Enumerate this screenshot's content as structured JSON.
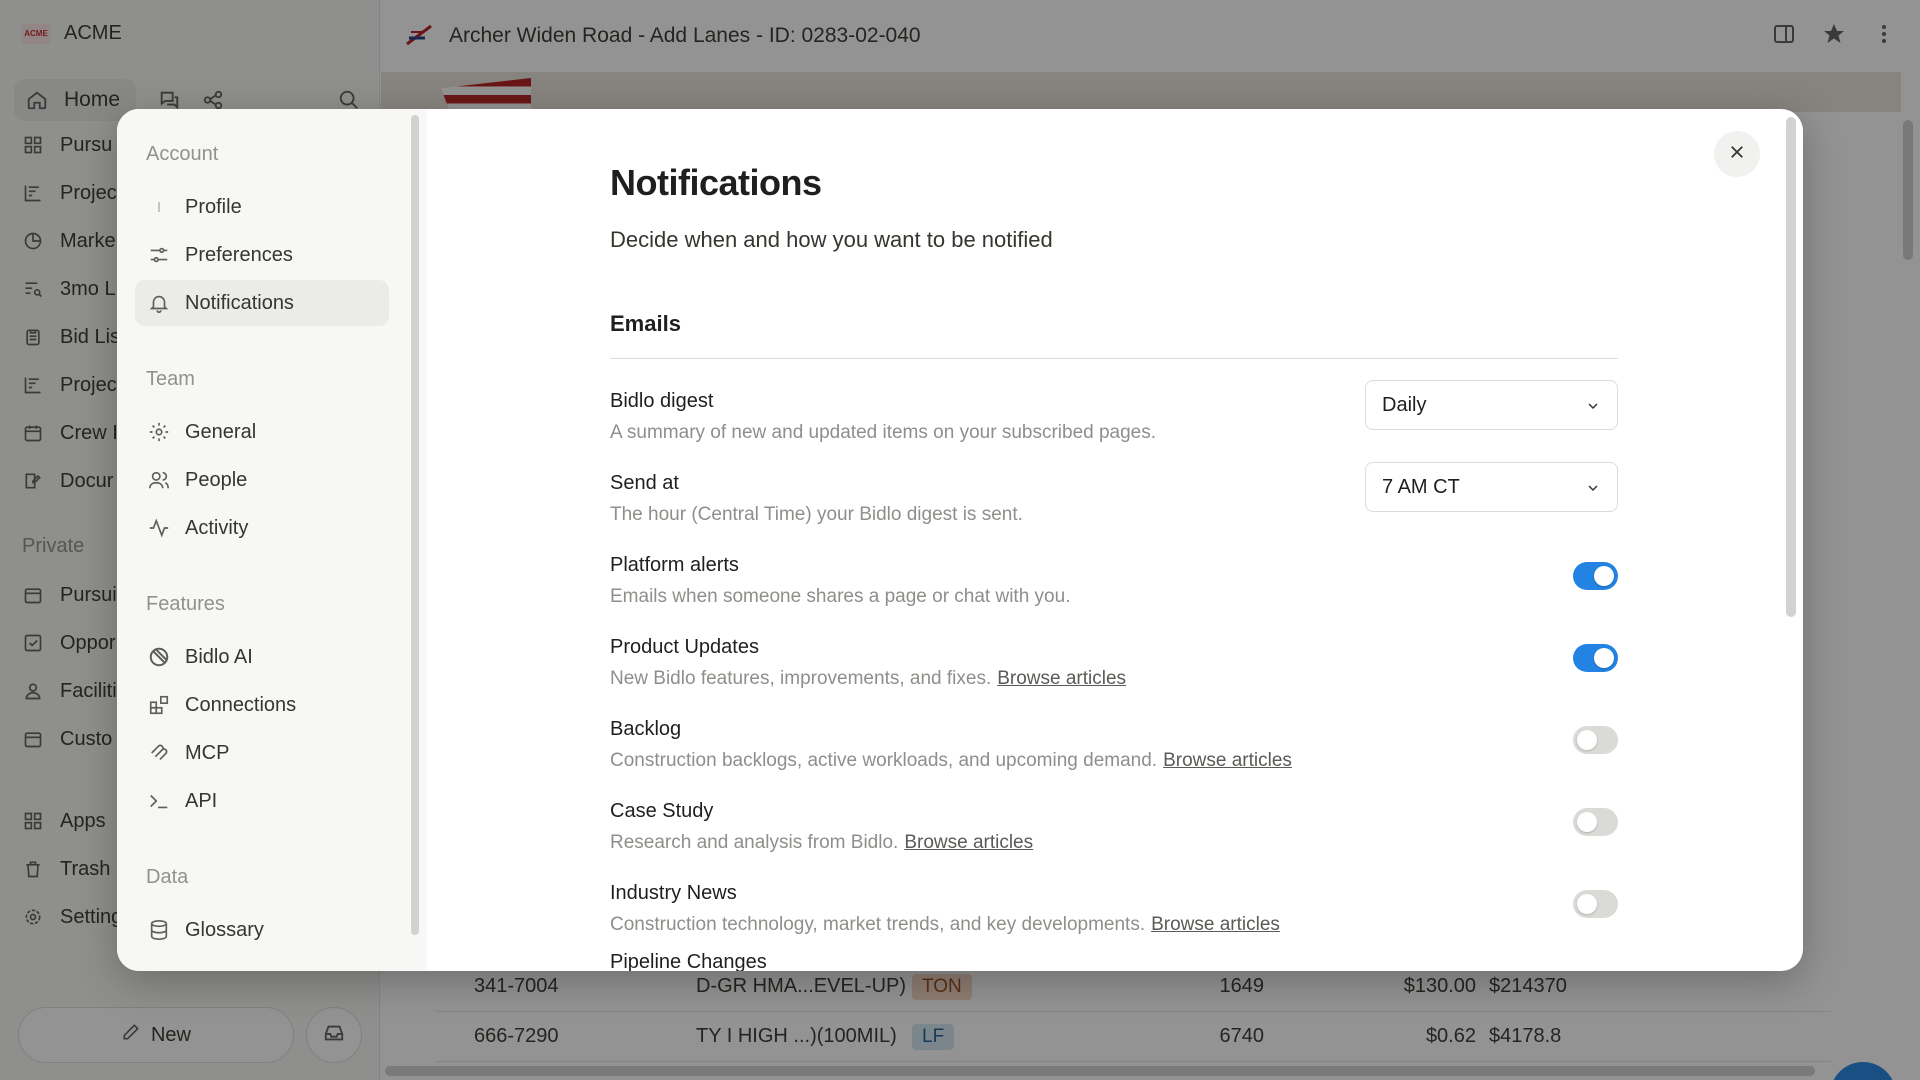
{
  "workspace": {
    "name": "ACME",
    "logo_text": "ACME"
  },
  "sidebar": {
    "home_label": "Home",
    "items": [
      {
        "label": "Pursu",
        "icon": "grid-icon"
      },
      {
        "label": "Projec",
        "icon": "chart-icon"
      },
      {
        "label": "Marke",
        "icon": "pie-icon"
      },
      {
        "label": "3mo L",
        "icon": "list-search-icon"
      },
      {
        "label": "Bid Lis",
        "icon": "clipboard-icon"
      },
      {
        "label": "Projec",
        "icon": "chart-icon"
      },
      {
        "label": "Crew I",
        "icon": "calendar-icon"
      },
      {
        "label": "Docur",
        "icon": "edit-doc-icon"
      }
    ],
    "private_label": "Private",
    "private_items": [
      {
        "label": "Pursui",
        "icon": "calendar-icon"
      },
      {
        "label": "Oppor",
        "icon": "checkbox-icon"
      },
      {
        "label": "Faciliti",
        "icon": "person-icon"
      },
      {
        "label": "Custo",
        "icon": "calendar-icon"
      }
    ],
    "bottom_items": [
      {
        "label": "Apps",
        "icon": "apps-icon"
      },
      {
        "label": "Trash",
        "icon": "trash-icon"
      },
      {
        "label": "Setting",
        "icon": "gear-icon"
      }
    ],
    "new_label": "New"
  },
  "topbar": {
    "title": "Archer Widen Road - Add Lanes - ID: 0283-02-040"
  },
  "table": {
    "rows": [
      {
        "code": "341-7004",
        "item": "D-GR HMA...EVEL-UP)",
        "unit": "TON",
        "unit_color": "#f6d8c4",
        "qty": "1649",
        "price": "$130.00",
        "total": "$214370"
      },
      {
        "code": "666-7290",
        "item": "TY I HIGH ...)(100MIL)",
        "unit": "LF",
        "unit_color": "#d3e5f3",
        "qty": "6740",
        "price": "$0.62",
        "total": "$4178.8"
      }
    ]
  },
  "settings_nav": {
    "sections": [
      {
        "title": "Account",
        "items": [
          {
            "label": "Profile",
            "icon": "profile-icon"
          },
          {
            "label": "Preferences",
            "icon": "sliders-icon"
          },
          {
            "label": "Notifications",
            "icon": "bell-icon",
            "active": true
          }
        ]
      },
      {
        "title": "Team",
        "items": [
          {
            "label": "General",
            "icon": "gear-icon"
          },
          {
            "label": "People",
            "icon": "people-icon"
          },
          {
            "label": "Activity",
            "icon": "activity-icon"
          }
        ]
      },
      {
        "title": "Features",
        "items": [
          {
            "label": "Bidlo AI",
            "icon": "ai-icon"
          },
          {
            "label": "Connections",
            "icon": "connections-icon"
          },
          {
            "label": "MCP",
            "icon": "mcp-icon"
          },
          {
            "label": "API",
            "icon": "terminal-icon"
          }
        ]
      },
      {
        "title": "Data",
        "items": [
          {
            "label": "Glossary",
            "icon": "database-icon"
          }
        ]
      }
    ]
  },
  "notifications": {
    "title": "Notifications",
    "subtitle": "Decide when and how you want to be notified",
    "section_title": "Emails",
    "settings": [
      {
        "label": "Bidlo digest",
        "desc": "A summary of new and updated items on your subscribed pages.",
        "control": "select",
        "value": "Daily"
      },
      {
        "label": "Send at",
        "desc": "The hour (Central Time) your Bidlo digest is sent.",
        "control": "select",
        "value": "7 AM CT"
      },
      {
        "label": "Platform alerts",
        "desc": "Emails when someone shares a page or chat with you.",
        "control": "toggle",
        "on": true
      },
      {
        "label": "Product Updates",
        "desc": "New Bidlo features, improvements, and fixes.",
        "link": "Browse articles",
        "control": "toggle",
        "on": true
      },
      {
        "label": "Backlog",
        "desc": "Construction backlogs, active workloads, and upcoming demand.",
        "link": "Browse articles",
        "control": "toggle",
        "on": false
      },
      {
        "label": "Case Study",
        "desc": "Research and analysis from Bidlo.",
        "link": "Browse articles",
        "control": "toggle",
        "on": false
      },
      {
        "label": "Industry News",
        "desc": "Construction technology, market trends, and key developments.",
        "link": "Browse articles",
        "control": "toggle",
        "on": false
      }
    ],
    "cut_label": "Pipeline Changes"
  },
  "colors": {
    "accent": "#2383e2",
    "toggle_off": "#dadad7",
    "overlay": "rgba(15,15,15,0.45)"
  }
}
